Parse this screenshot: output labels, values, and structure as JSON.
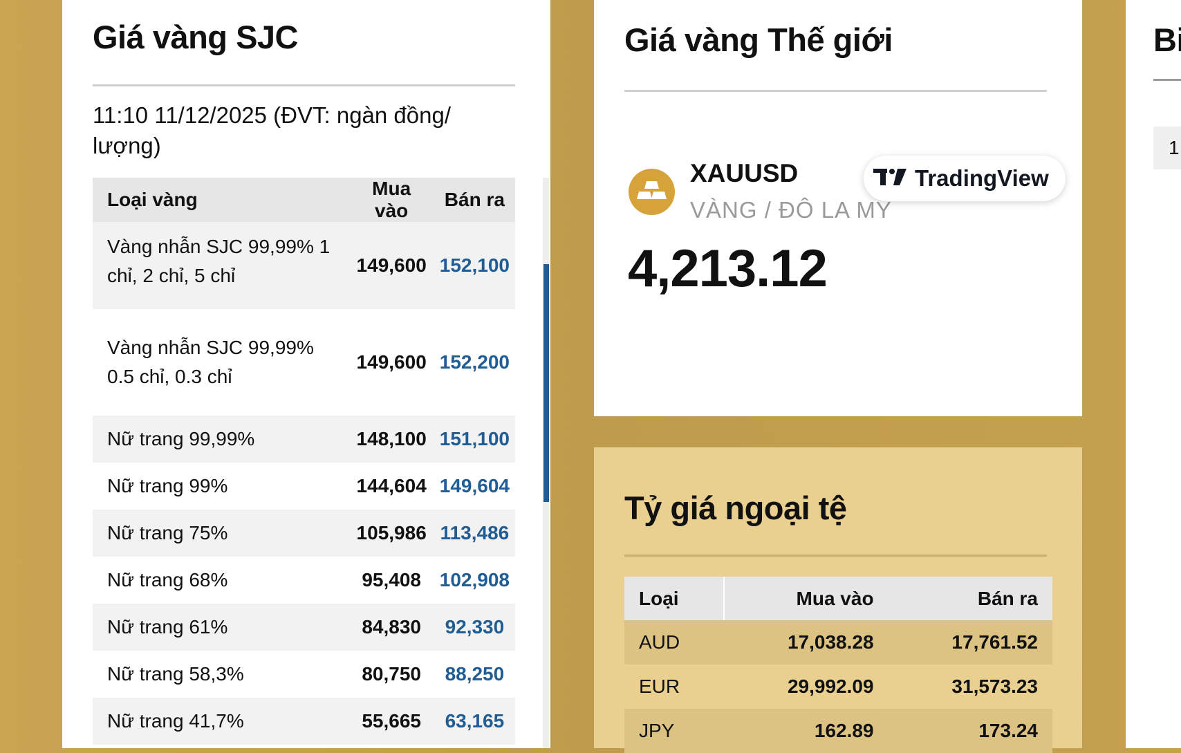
{
  "sjc": {
    "title": "Giá vàng SJC",
    "updated": "11:10 11/12/2025 (ĐVT: ngàn đồng/ lượng)",
    "columns": [
      "Loại vàng",
      "Mua vào",
      "Bán ra"
    ],
    "rows": [
      {
        "label": "Vàng nhẫn SJC 99,99% 1 chỉ, 2 chỉ, 5 chỉ",
        "buy": "149,600",
        "sell": "152,100"
      },
      {
        "label": "Vàng nhẫn SJC 99,99% 0.5 chỉ, 0.3 chỉ",
        "buy": "149,600",
        "sell": "152,200"
      },
      {
        "label": "Nữ trang 99,99%",
        "buy": "148,100",
        "sell": "151,100"
      },
      {
        "label": "Nữ trang 99%",
        "buy": "144,604",
        "sell": "149,604"
      },
      {
        "label": "Nữ trang 75%",
        "buy": "105,986",
        "sell": "113,486"
      },
      {
        "label": "Nữ trang 68%",
        "buy": "95,408",
        "sell": "102,908"
      },
      {
        "label": "Nữ trang 61%",
        "buy": "84,830",
        "sell": "92,330"
      },
      {
        "label": "Nữ trang 58,3%",
        "buy": "80,750",
        "sell": "88,250"
      },
      {
        "label": "Nữ trang 41,7%",
        "buy": "55,665",
        "sell": "63,165"
      }
    ]
  },
  "world": {
    "title": "Giá vàng Thế giới",
    "symbol": "XAUUSD",
    "symbol_desc": "VÀNG / ĐÔ LA MỸ",
    "price": "4,213.12",
    "badge": "TradingView"
  },
  "fx": {
    "title": "Tỷ giá ngoại tệ",
    "columns": [
      "Loại",
      "Mua vào",
      "Bán ra"
    ],
    "rows": [
      {
        "code": "AUD",
        "buy": "17,038.28",
        "sell": "17,761.52"
      },
      {
        "code": "EUR",
        "buy": "29,992.09",
        "sell": "31,573.23"
      },
      {
        "code": "JPY",
        "buy": "162.89",
        "sell": "173.24"
      }
    ]
  },
  "right": {
    "title_partial": "Bi",
    "tab_partial": "1"
  },
  "colors": {
    "background": "#c4a150",
    "sell_blue": "#1f5d94",
    "fx_panel": "#e9d090",
    "gold_logo": "#d6a23a"
  }
}
